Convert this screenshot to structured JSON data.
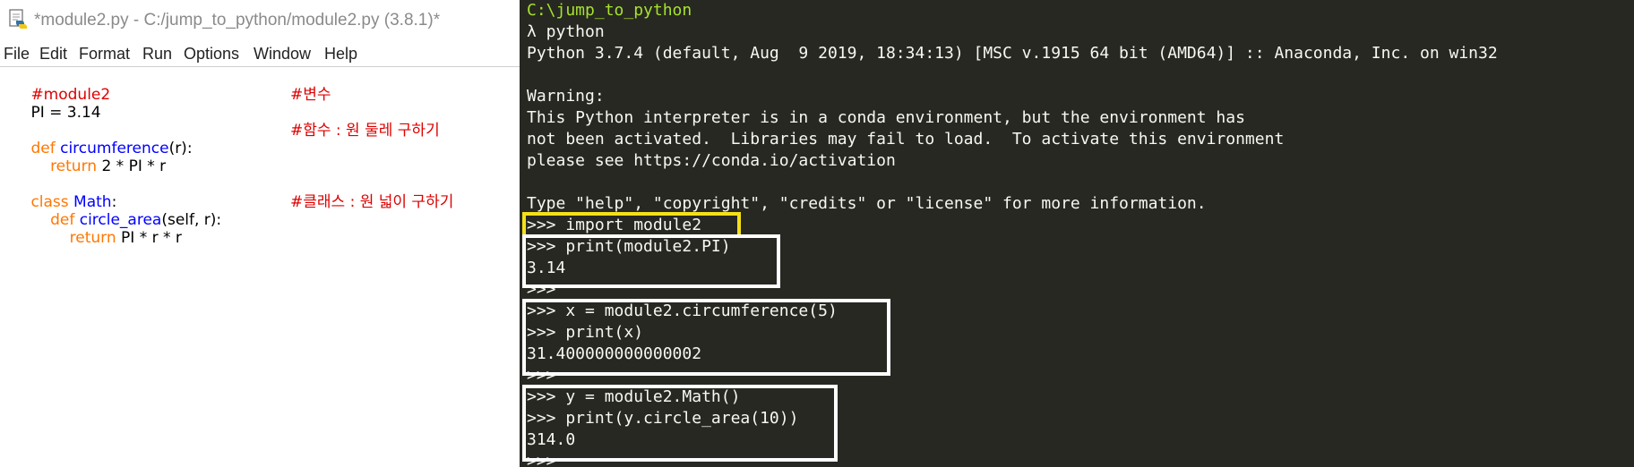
{
  "idle": {
    "title": "*module2.py - C:/jump_to_python/module2.py (3.8.1)*",
    "menu": [
      "File",
      "Edit",
      "Format",
      "Run",
      "Options",
      "Window",
      "Help"
    ],
    "code": {
      "l1": "#module2",
      "l2": "PI = 3.14",
      "l2_comment": "#변수",
      "l3_kw": "def",
      "l3_name": "circumference",
      "l3_rest": "(r):",
      "l3_comment": "#함수 : 원 둘레 구하기",
      "l4_kw": "return",
      "l4_rest": " 2 * PI * r",
      "l5_kw": "class",
      "l5_name": "Math",
      "l5_rest": ":",
      "l6_kw": "def",
      "l6_name": "circle_area",
      "l6_rest": "(self, r):",
      "l6_comment": "#클래스 : 원 넓이 구하기",
      "l7_kw": "return",
      "l7_rest": " PI * r * r"
    }
  },
  "console": {
    "lines": [
      "C:\\jump_to_python",
      "λ python",
      "Python 3.7.4 (default, Aug  9 2019, 18:34:13) [MSC v.1915 64 bit (AMD64)] :: Anaconda, Inc. on win32",
      "",
      "Warning:",
      "This Python interpreter is in a conda environment, but the environment has",
      "not been activated.  Libraries may fail to load.  To activate this environment",
      "please see https://conda.io/activation",
      "",
      "Type \"help\", \"copyright\", \"credits\" or \"license\" for more information.",
      ">>> import module2",
      ">>> print(module2.PI)",
      "3.14",
      ">>>",
      ">>> x = module2.circumference(5)",
      ">>> print(x)",
      "31.400000000000002",
      ">>>",
      ">>> y = module2.Math()",
      ">>> print(y.circle_area(10))",
      "314.0",
      ">>>"
    ]
  },
  "colors": {
    "console_bg": "#272822",
    "console_text": "#f8f8f2",
    "console_path": "#a6e22e",
    "highlight_yellow": "#f4e01a",
    "highlight_white": "#ffffff",
    "idle_comment": "#dd0000",
    "idle_keyword": "#ff7700",
    "idle_definition": "#0000ff"
  },
  "icons": [
    "python-file-icon"
  ]
}
